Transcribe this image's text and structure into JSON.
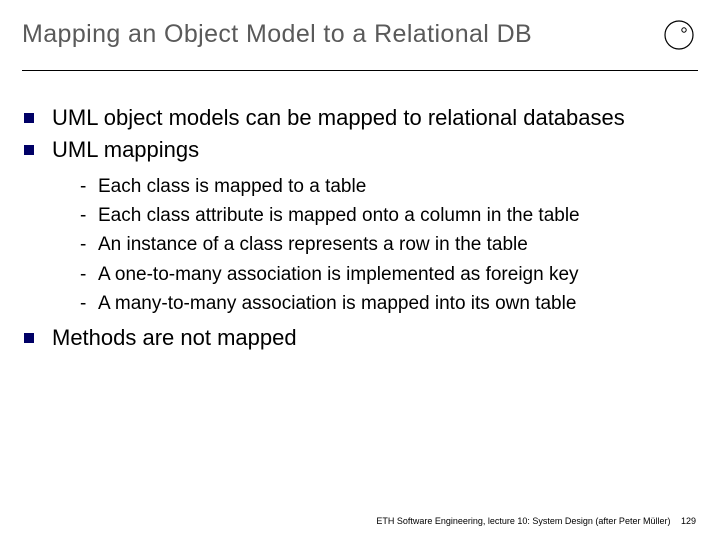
{
  "title": "Mapping an Object Model to a Relational DB",
  "bullets": {
    "b1": "UML object models can be mapped to relational databases",
    "b2": "UML mappings",
    "sub": {
      "s1": "Each class is mapped to a table",
      "s2": "Each class attribute is mapped onto a column in the table",
      "s3": "An instance of a class represents a row in the table",
      "s4": "A one-to-many association is implemented as foreign key",
      "s5": "A many-to-many association is mapped into its own table"
    },
    "b3": "Methods are not mapped"
  },
  "footer": {
    "text": "ETH Software Engineering, lecture 10: System Design (after Peter Müller)",
    "slide_number": "129"
  },
  "logo_name": "eth-circle-logo"
}
